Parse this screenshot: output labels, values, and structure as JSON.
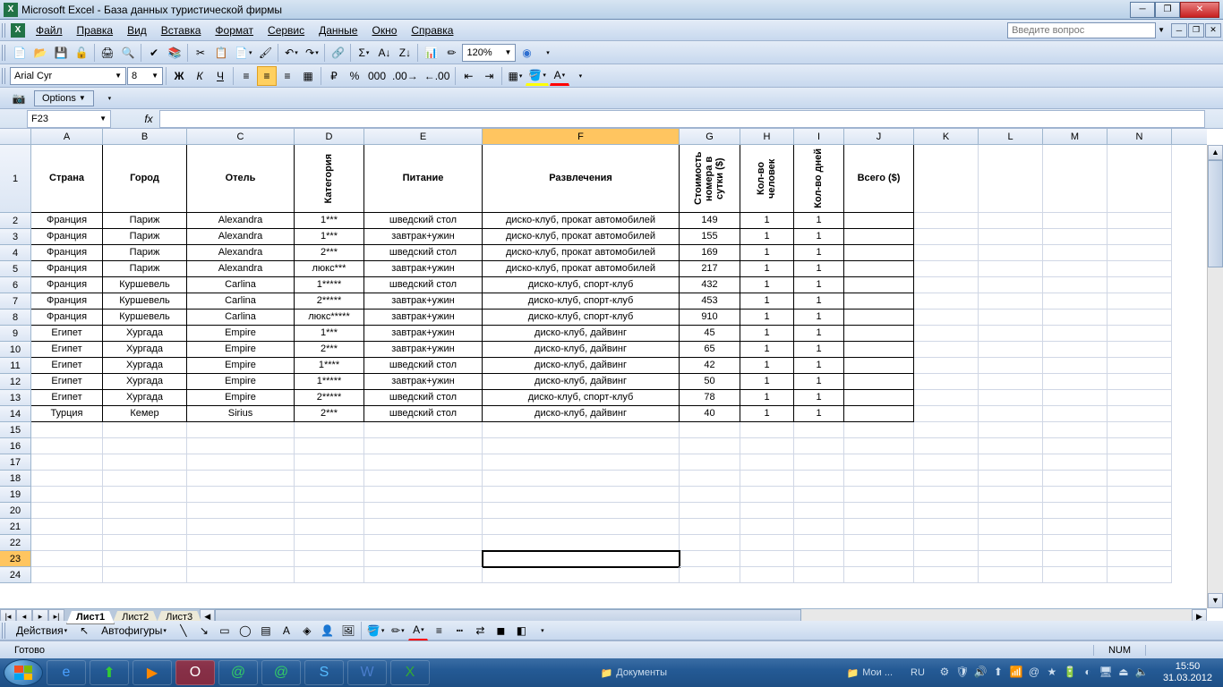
{
  "title": "Microsoft Excel - База данных туристической фирмы",
  "menu": {
    "file": "Файл",
    "edit": "Правка",
    "view": "Вид",
    "insert": "Вставка",
    "format": "Формат",
    "tools": "Сервис",
    "data": "Данные",
    "window": "Окно",
    "help": "Справка"
  },
  "help_placeholder": "Введите вопрос",
  "font": {
    "name": "Arial Cyr",
    "size": "8"
  },
  "zoom": "120%",
  "options_label": "Options",
  "name_box": "F23",
  "fx": "fx",
  "formula_value": "",
  "columns": [
    "A",
    "B",
    "C",
    "D",
    "E",
    "F",
    "G",
    "H",
    "I",
    "J",
    "K",
    "L",
    "M",
    "N"
  ],
  "headers": {
    "A": "Страна",
    "B": "Город",
    "C": "Отель",
    "D": "Категория",
    "E": "Питание",
    "F": "Развлечения",
    "G": "Стоимость номера в сутки ($)",
    "H": "Кол-во человек",
    "I": "Кол-во дней",
    "J": "Всего ($)"
  },
  "rows": [
    {
      "n": 2,
      "A": "Франция",
      "B": "Париж",
      "C": "Alexandra",
      "D": "1***",
      "E": "шведский стол",
      "F": "диско-клуб, прокат автомобилей",
      "G": "149",
      "H": "1",
      "I": "1",
      "J": ""
    },
    {
      "n": 3,
      "A": "Франция",
      "B": "Париж",
      "C": "Alexandra",
      "D": "1***",
      "E": "завтрак+ужин",
      "F": "диско-клуб, прокат автомобилей",
      "G": "155",
      "H": "1",
      "I": "1",
      "J": ""
    },
    {
      "n": 4,
      "A": "Франция",
      "B": "Париж",
      "C": "Alexandra",
      "D": "2***",
      "E": "шведский стол",
      "F": "диско-клуб, прокат автомобилей",
      "G": "169",
      "H": "1",
      "I": "1",
      "J": ""
    },
    {
      "n": 5,
      "A": "Франция",
      "B": "Париж",
      "C": "Alexandra",
      "D": "люкс***",
      "E": "завтрак+ужин",
      "F": "диско-клуб, прокат автомобилей",
      "G": "217",
      "H": "1",
      "I": "1",
      "J": ""
    },
    {
      "n": 6,
      "A": "Франция",
      "B": "Куршевель",
      "C": "Carlina",
      "D": "1*****",
      "E": "шведский стол",
      "F": "диско-клуб, спорт-клуб",
      "G": "432",
      "H": "1",
      "I": "1",
      "J": ""
    },
    {
      "n": 7,
      "A": "Франция",
      "B": "Куршевель",
      "C": "Carlina",
      "D": "2*****",
      "E": "завтрак+ужин",
      "F": "диско-клуб, спорт-клуб",
      "G": "453",
      "H": "1",
      "I": "1",
      "J": ""
    },
    {
      "n": 8,
      "A": "Франция",
      "B": "Куршевель",
      "C": "Carlina",
      "D": "люкс*****",
      "E": "завтрак+ужин",
      "F": "диско-клуб, спорт-клуб",
      "G": "910",
      "H": "1",
      "I": "1",
      "J": ""
    },
    {
      "n": 9,
      "A": "Египет",
      "B": "Хургада",
      "C": "Empire",
      "D": "1***",
      "E": "завтрак+ужин",
      "F": "диско-клуб, дайвинг",
      "G": "45",
      "H": "1",
      "I": "1",
      "J": ""
    },
    {
      "n": 10,
      "A": "Египет",
      "B": "Хургада",
      "C": "Empire",
      "D": "2***",
      "E": "завтрак+ужин",
      "F": "диско-клуб, дайвинг",
      "G": "65",
      "H": "1",
      "I": "1",
      "J": ""
    },
    {
      "n": 11,
      "A": "Египет",
      "B": "Хургада",
      "C": "Empire",
      "D": "1****",
      "E": "шведский стол",
      "F": "диско-клуб, дайвинг",
      "G": "42",
      "H": "1",
      "I": "1",
      "J": ""
    },
    {
      "n": 12,
      "A": "Египет",
      "B": "Хургада",
      "C": "Empire",
      "D": "1*****",
      "E": "завтрак+ужин",
      "F": "диско-клуб, дайвинг",
      "G": "50",
      "H": "1",
      "I": "1",
      "J": ""
    },
    {
      "n": 13,
      "A": "Египет",
      "B": "Хургада",
      "C": "Empire",
      "D": "2*****",
      "E": "шведский стол",
      "F": "диско-клуб, спорт-клуб",
      "G": "78",
      "H": "1",
      "I": "1",
      "J": ""
    },
    {
      "n": 14,
      "A": "Турция",
      "B": "Кемер",
      "C": "Sirius",
      "D": "2***",
      "E": "шведский стол",
      "F": "диско-клуб, дайвинг",
      "G": "40",
      "H": "1",
      "I": "1",
      "J": ""
    }
  ],
  "empty_rows": [
    15,
    16,
    17,
    18,
    19,
    20,
    21,
    22,
    23,
    24
  ],
  "active_cell_row": 23,
  "selected_col": "F",
  "sheets": [
    "Лист1",
    "Лист2",
    "Лист3"
  ],
  "active_sheet": "Лист1",
  "draw_label": "Действия",
  "autoshapes_label": "Автофигуры",
  "status": {
    "ready": "Готово",
    "num": "NUM"
  },
  "taskbar": {
    "docs": "Документы",
    "my": "Мои ...",
    "lang": "RU",
    "time": "15:50",
    "date": "31.03.2012"
  }
}
